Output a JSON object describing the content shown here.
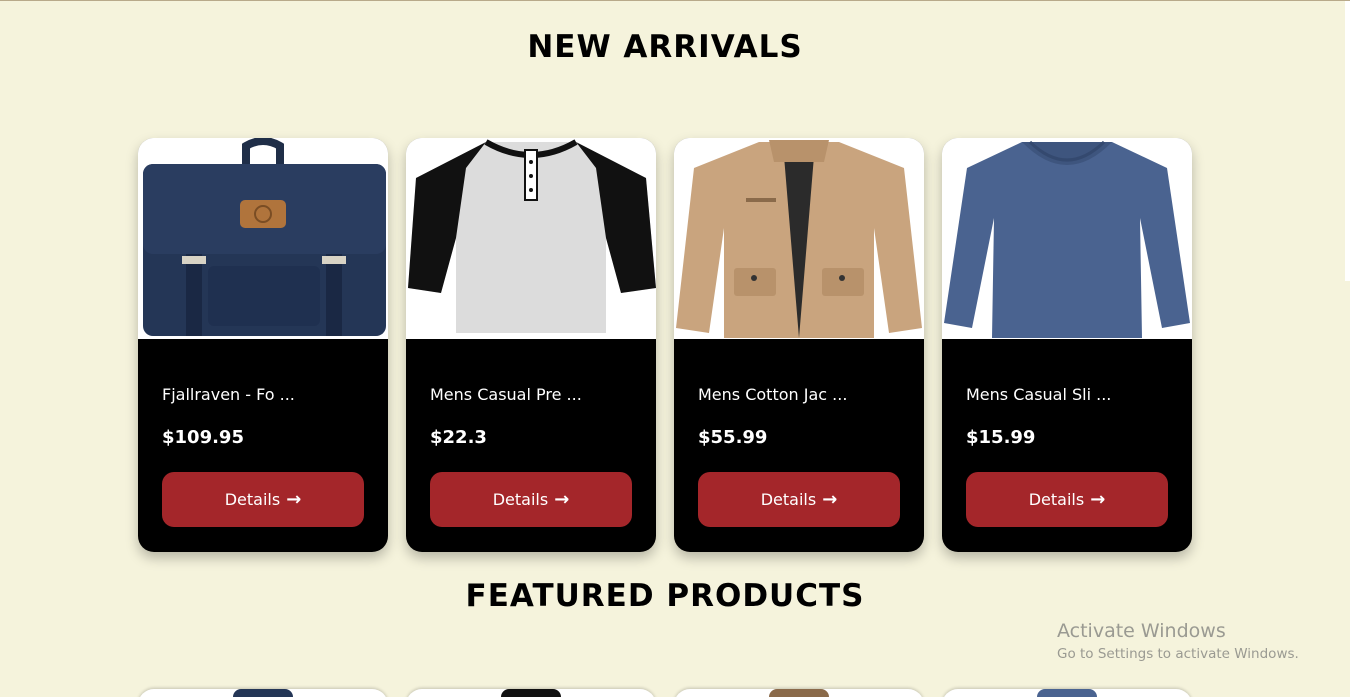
{
  "sections": {
    "new_arrivals": {
      "title": "NEW ARRIVALS"
    },
    "featured": {
      "title": "FEATURED PRODUCTS"
    }
  },
  "products": [
    {
      "title": "Fjallraven - Fo ...",
      "price": "$109.95",
      "button": "Details",
      "image": "backpack-image"
    },
    {
      "title": "Mens Casual Pre ...",
      "price": "$22.3",
      "button": "Details",
      "image": "henley-tshirt-image"
    },
    {
      "title": "Mens Cotton Jac ...",
      "price": "$55.99",
      "button": "Details",
      "image": "cotton-jacket-image"
    },
    {
      "title": "Mens Casual Sli ...",
      "price": "$15.99",
      "button": "Details",
      "image": "slim-longsleeve-image"
    }
  ],
  "icons": {
    "details_arrow": "arrow-right-icon"
  },
  "colors": {
    "background": "#f5f3dc",
    "card": "#000000",
    "button": "#a4262a"
  },
  "watermark": {
    "title": "Activate Windows",
    "subtitle": "Go to Settings to activate Windows."
  }
}
